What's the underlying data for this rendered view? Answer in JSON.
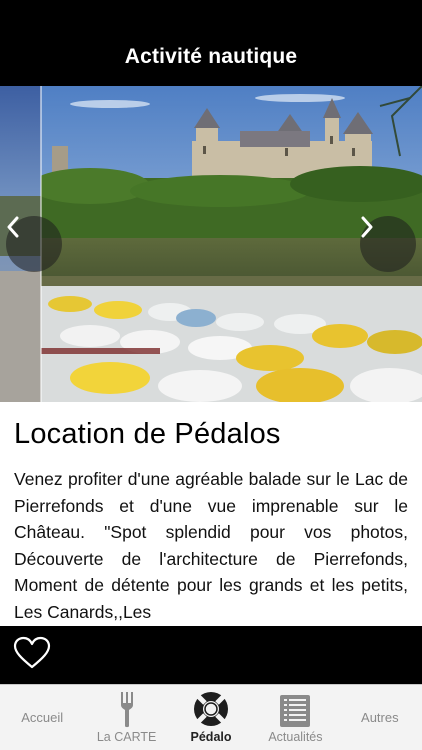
{
  "header": {
    "title": "Activité nautique"
  },
  "gallery": {
    "prev_icon": "chevron-left-icon",
    "next_icon": "chevron-right-icon"
  },
  "article": {
    "title": "Location de Pédalos",
    "body": "Venez profiter d'une agréable balade sur le Lac de Pierrefonds et d'une vue imprenable sur le Château. \"Spot splendid pour vos photos, Découverte de l'architecture de Pierrefonds, Moment de détente pour les grands et les petits, Les Canards,,Les"
  },
  "actions": {
    "favorite_icon": "heart-outline-icon"
  },
  "tabbar": {
    "tabs": [
      {
        "label": "Accueil",
        "icon": ""
      },
      {
        "label": "La CARTE",
        "icon": "fork-icon"
      },
      {
        "label": "Pédalo",
        "icon": "lifebuoy-icon",
        "active": true
      },
      {
        "label": "Actualités",
        "icon": "news-icon"
      },
      {
        "label": "Autres",
        "icon": ""
      }
    ]
  },
  "colors": {
    "bar": "#000000",
    "tab_background": "#f3f3f3",
    "tab_label": "#8a8a8a"
  }
}
